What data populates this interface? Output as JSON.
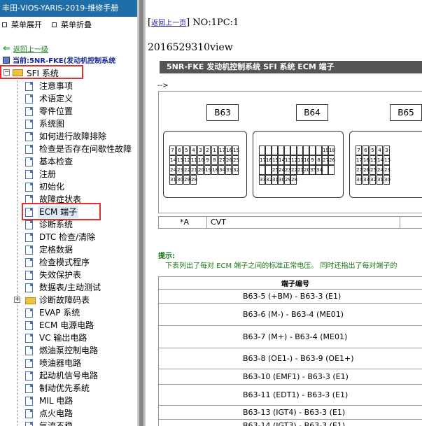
{
  "app": {
    "title": "丰田-VIOS-YARIS-2019-维修手册",
    "menu_expand": "菜单展开",
    "menu_collapse": "菜单折叠"
  },
  "nav": {
    "back_link": "返回上一级",
    "current": "当前:5NR-FKE(发动机控制系统"
  },
  "tree": {
    "root": "SFI 系统",
    "items": [
      {
        "label": "注意事项",
        "type": "doc"
      },
      {
        "label": "术语定义",
        "type": "doc"
      },
      {
        "label": "零件位置",
        "type": "doc"
      },
      {
        "label": "系统图",
        "type": "doc"
      },
      {
        "label": "如何进行故障排除",
        "type": "doc"
      },
      {
        "label": "检查是否存在间歇性故障",
        "type": "doc"
      },
      {
        "label": "基本检查",
        "type": "doc"
      },
      {
        "label": "注册",
        "type": "doc"
      },
      {
        "label": "初始化",
        "type": "doc"
      },
      {
        "label": "故障症状表",
        "type": "doc"
      },
      {
        "label": "ECM 端子",
        "type": "doc",
        "selected": true
      },
      {
        "label": "诊断系统",
        "type": "doc"
      },
      {
        "label": "DTC 检查/清除",
        "type": "doc"
      },
      {
        "label": "定格数据",
        "type": "doc"
      },
      {
        "label": "检查模式程序",
        "type": "doc"
      },
      {
        "label": "失效保护表",
        "type": "doc"
      },
      {
        "label": "数据表/主动测试",
        "type": "doc"
      },
      {
        "label": "诊断故障码表",
        "type": "folder"
      },
      {
        "label": "EVAP 系统",
        "type": "doc"
      },
      {
        "label": "ECM 电源电路",
        "type": "doc"
      },
      {
        "label": "VC 输出电路",
        "type": "doc"
      },
      {
        "label": "燃油泵控制电路",
        "type": "doc"
      },
      {
        "label": "喷油器电路",
        "type": "doc"
      },
      {
        "label": "起动机信号电路",
        "type": "doc"
      },
      {
        "label": "制动优先系统",
        "type": "doc"
      },
      {
        "label": "MIL 电路",
        "type": "doc"
      },
      {
        "label": "点火电路",
        "type": "doc"
      },
      {
        "label": "气流不稳",
        "type": "doc"
      }
    ]
  },
  "content": {
    "return_top": "返回上一页",
    "page_no": "NO:1PC:1",
    "doc_id": "2016529310view",
    "section_header": "5NR-FKE 发动机控制系统  SFI 系统  ECM 端子",
    "arrow_text": "-->",
    "connectors": [
      "B63",
      "B64",
      "B65"
    ],
    "legend_a": "*A",
    "legend_b": "CVT",
    "hint_title": "提示:",
    "hint_body": "下表列出了每对 ECM 端子之间的标准正常电压。 同时还指出了每对端子的",
    "table_header": "端子编号",
    "rows": [
      "B63-5 (+BM) - B63-3 (E1)",
      "B63-6 (M-) - B63-4 (ME01)",
      "B63-7 (M+) - B63-4 (ME01)",
      "B63-8 (OE1-) - B63-9 (OE1+)",
      "B63-10 (EMF1) - B63-3 (E1)",
      "B63-11 (EDT1) - B63-3 (E1)",
      "B63-13 (IGT4) - B63-3 (E1)",
      "B63-14 (IGT3) - B63-3 (E1)"
    ],
    "pins_b63": [
      [
        "7",
        "6",
        "5",
        "4",
        "3",
        "2",
        "1"
      ],
      [
        "17",
        "16",
        "15",
        "14",
        "13",
        "12",
        "11",
        "10",
        "9",
        "8"
      ],
      [
        "27",
        "26",
        "25",
        "24",
        "23",
        "22",
        "21",
        "20",
        "19",
        "18"
      ],
      [
        "34",
        "33",
        "32",
        "31",
        "30",
        "29",
        "28"
      ]
    ],
    "pins_b64": [
      [
        "",
        "",
        "",
        "",
        "",
        "",
        "",
        "",
        "",
        ""
      ],
      [
        "19",
        "18",
        "17",
        "16",
        "15",
        "14",
        "13",
        "12",
        "11",
        "10",
        "9",
        "8"
      ],
      [
        "27",
        "26",
        "",
        "",
        "25",
        "24",
        "23",
        "22",
        "21",
        "20"
      ],
      [
        "35",
        "34",
        "",
        "",
        "33",
        "32",
        "31",
        "30",
        "29",
        "28"
      ]
    ],
    "pins_b65": [
      [
        "7",
        "6",
        "5",
        "4",
        "3"
      ],
      [
        "17",
        "16",
        "15",
        "14",
        "13"
      ],
      [
        "27",
        "26",
        "25",
        "24",
        "23"
      ],
      [
        "34",
        "33",
        "32",
        "31",
        "30"
      ]
    ]
  }
}
